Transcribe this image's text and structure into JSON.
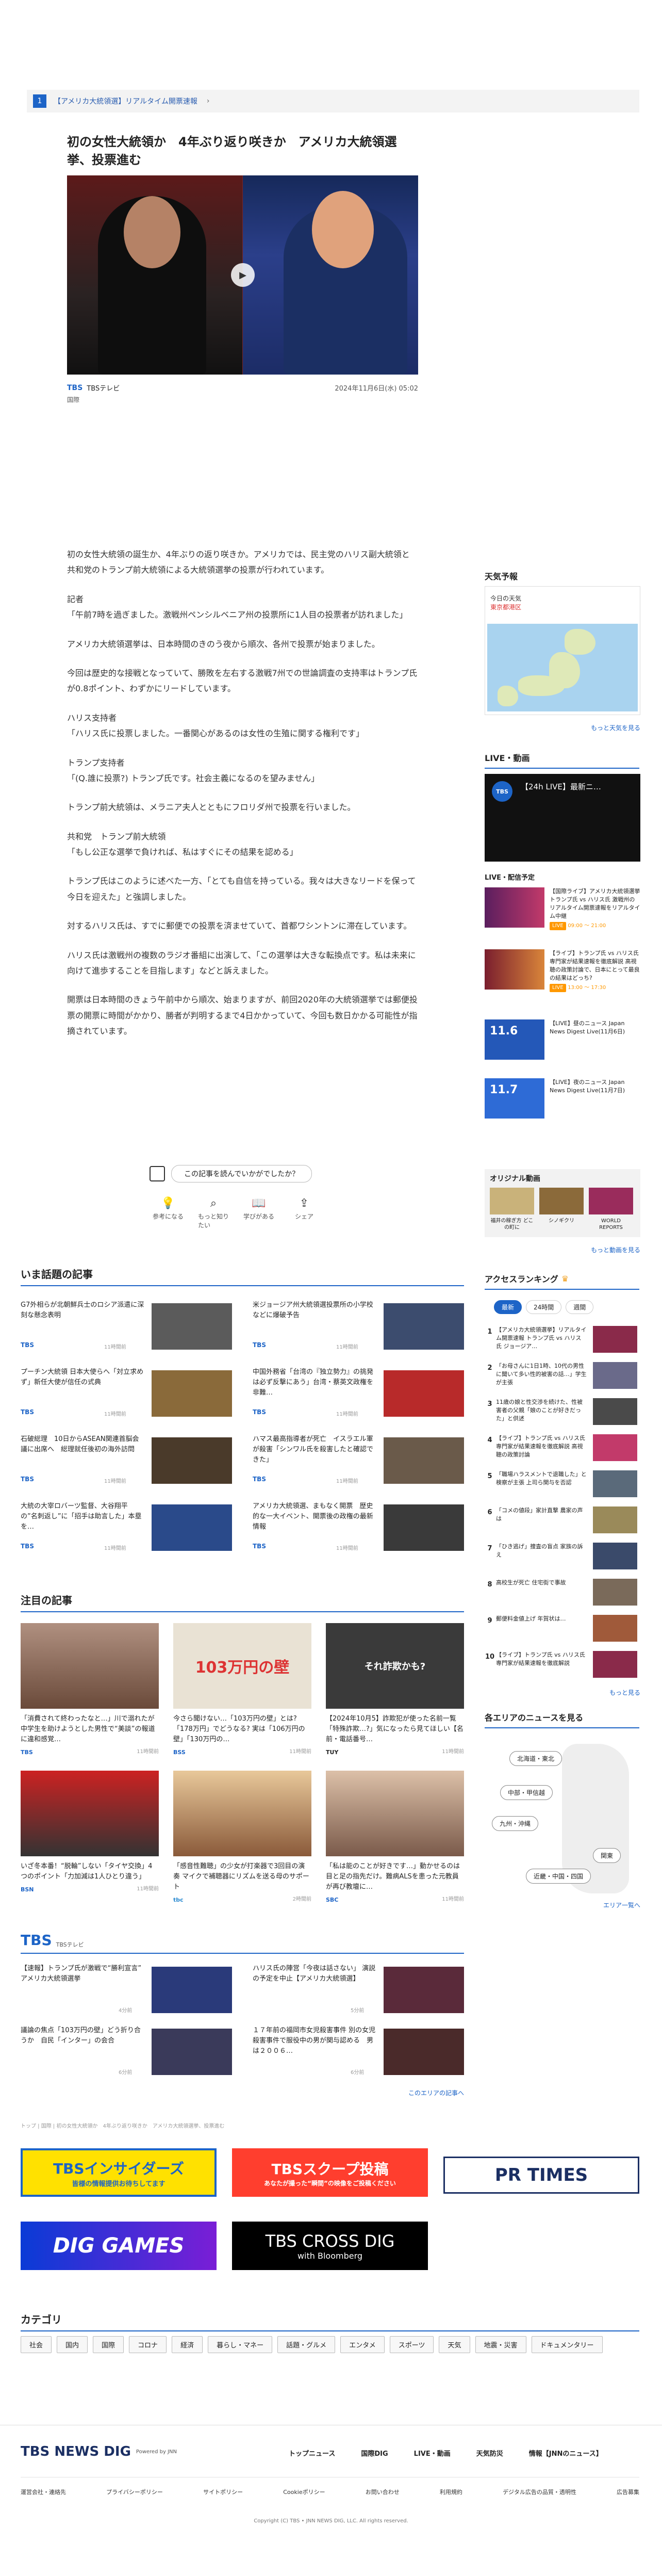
{
  "pager": {
    "num": "1",
    "label": "【アメリカ大統領選】リアルタイム開票速報"
  },
  "article": {
    "title": "初の女性大統領か　4年ぶり返り咲きか　アメリカ大統領選挙、投票進む",
    "media": "TBS",
    "media_sub": "TBSテレビ",
    "date": "2024年11月6日(水) 05:02",
    "category": "国際",
    "paragraphs": [
      "初の女性大統領の誕生か、4年ぶりの返り咲きか。アメリカでは、民主党のハリス副大統領と共和党のトランプ前大統領による大統領選挙の投票が行われています。",
      "記者\n「午前7時を過ぎました。激戦州ペンシルベニア州の投票所に1人目の投票者が訪れました」",
      "アメリカ大統領選挙は、日本時間のきのう夜から順次、各州で投票が始まりました。",
      "今回は歴史的な接戦となっていて、勝敗を左右する激戦7州での世論調査の支持率はトランプ氏が0.8ポイント、わずかにリードしています。",
      "ハリス支持者\n「ハリス氏に投票しました。一番関心があるのは女性の生殖に関する権利です」",
      "トランプ支持者\n「(Q.誰に投票?) トランプ氏です。社会主義になるのを望みません」",
      "トランプ前大統領は、メラニア夫人とともにフロリダ州で投票を行いました。",
      "共和党　トランプ前大統領\n「もし公正な選挙で負ければ、私はすぐにその結果を認める」",
      "トランプ氏はこのように述べた一方、「とても自信を持っている。我々は大きなリードを保って今日を迎えた」と強調しました。",
      "対するハリス氏は、すでに郵便での投票を済ませていて、首都ワシントンに滞在しています。",
      "ハリス氏は激戦州の複数のラジオ番組に出演して、「この選挙は大きな転換点です。私は未来に向けて進歩することを目指します」などと訴えました。",
      "開票は日本時間のきょう午前中から順次、始まりますが、前回2020年の大統領選挙では郵便投票の開票に時間がかかり、勝者が判明するまで4日かかっていて、今回も数日かかる可能性が指摘されています。"
    ],
    "feedback_label": "この記事を読んでいかがでしたか？",
    "reactions": [
      "参考になる",
      "もっと知りたい",
      "学びがある",
      "シェア"
    ]
  },
  "sidebar": {
    "weather_title": "天気予報",
    "weather_loc_prefix": "今日の天気",
    "weather_loc": "東京都港区",
    "weather_more": "もっと天気を見る",
    "live_title": "LIVE・動画",
    "live_video": "【24h LIVE】最新ニ…",
    "schedule_title": "LIVE・配信予定",
    "schedule": [
      {
        "text": "【国際ライブ】アメリカ大統領選挙 トランプ氏 vs ハリス氏 激戦州のリアルタイム開票速報をリアルタイム中継",
        "badge": "LIVE",
        "time": "09:00 〜 21:00"
      },
      {
        "text": "【ライブ】トランプ氏 vs ハリス氏 専門家が結果速報を徹底解説 高視聴の政策討論で、日本にとって最良の結果はどっち?",
        "badge": "LIVE",
        "time": "13:00 〜 17:30"
      },
      {
        "text": "【LIVE】昼のニュース Japan News Digest Live(11月6日)",
        "badge": "11.6",
        "time": ""
      },
      {
        "text": "【LIVE】夜のニュース Japan News Digest Live(11月7日)",
        "badge": "11.7",
        "time": ""
      }
    ],
    "original_title": "オリジナル動画",
    "original_items": [
      "福井の稼ぎ方 どこの町に",
      "シノギクリ",
      "WORLD REPORTS"
    ],
    "original_more": "もっと動画を見る",
    "ranking_title": "アクセスランキング",
    "ranking_tabs": [
      "最新",
      "24時間",
      "週間"
    ],
    "ranking": [
      "【アメリカ大統領選挙】リアルタイム開票速報 トランプ氏 vs ハリス氏 ジョージア…",
      "「お母さんに1日1時、10代の男性に聞いて多い性的被害の話…」学生が主張",
      "11歳の娘と性交渉を続けた、性被害者の父親「娘のことが好きだった」と供述",
      "【ライブ】トランプ氏 vs ハリス氏 専門家が結果速報を徹底解説 高視聴の政策討論",
      "「職場ハラスメントで退職した」と検察が主張 上司ら関与を否認",
      "「コメの値段」家計直撃 農家の声は",
      "「ひき逃げ」捜査の盲点 家族の訴え",
      "高校生が死亡 住宅街で事故",
      "郵便料金値上げ 年賀状は…",
      "【ライブ】トランプ氏 vs ハリス氏 専門家が結果速報を徹底解説"
    ],
    "ranking_more": "もっと見る",
    "area_title": "各エリアのニュースを見る",
    "areas": [
      "北海道・東北",
      "中部・甲信越",
      "九州・沖縄",
      "関東",
      "近畿・中国・四国"
    ],
    "area_more": "エリア一覧へ"
  },
  "topics": {
    "title": "いま話題の記事",
    "items": [
      {
        "t": "G7外相らが北朝鮮兵士のロシア派遣に深刻な懸念表明",
        "m": "TBS",
        "d": "11時間前"
      },
      {
        "t": "米ジョージア州大統領選投票所の小学校などに爆破予告",
        "m": "TBS",
        "d": "11時間前"
      },
      {
        "t": "プーチン大統領 日本大使らへ「対立求めず」新任大使が信任の式典",
        "m": "TBS",
        "d": "11時間前"
      },
      {
        "t": "中国外務省「台湾の『独立勢力』の挑発は必ず反撃にあう」台湾・蔡英文政権を非難…",
        "m": "TBS",
        "d": "11時間前"
      },
      {
        "t": "石破総理　10日からASEAN関連首脳会議に出席へ　総理就任後初の海外訪問",
        "m": "TBS",
        "d": "11時間前"
      },
      {
        "t": "ハマス最高指導者が死亡　イスラエル軍が殺害「シンワル氏を殺害したと確認できた」",
        "m": "TBS",
        "d": "11時間前"
      },
      {
        "t": "大統の大宰ロバーツ監督、大谷翔平の”名刺返し”に「招手は助言した」本塁を…",
        "m": "TBS",
        "d": "11時間前"
      },
      {
        "t": "アメリカ大統領選、まもなく開票　歴史的な一大イベント、開票後の政権の最新情報",
        "m": "TBS",
        "d": "11時間前"
      }
    ]
  },
  "featured": {
    "title": "注目の記事",
    "cards": [
      {
        "t": "「消費されて終わったなと…」川で溺れたが中学生を助けようとした男性で“美談”の報道に違和感覚…",
        "m": "TBS",
        "d": "11時間前",
        "img_text": ""
      },
      {
        "t": "今さら聞けない…「103万円の壁」とは? 「178万円」でどうなる? 実は「106万円の壁」「130万円の…",
        "m": "BSS",
        "d": "11時間前",
        "img_text": "103万円の壁"
      },
      {
        "t": "【2024年10月5】詐欺犯が使った名前一覧「特殊詐欺…?」気になったら見てほしい【名前・電話番号…",
        "m": "TUY",
        "d": "11時間前",
        "img_text": "それ詐欺かも?"
      },
      {
        "t": "いざ冬本番！“脱輪”しない「タイヤ交換」4つのポイント「力加減は1人ひとり違う」",
        "m": "BSN",
        "d": "11時間前",
        "img_text": ""
      },
      {
        "t": "「感音性難聴」の少女が打楽器で3回目の演奏 マイクで補聴器にリズムを送る母のサポート",
        "m": "tbc",
        "d": "2時間前",
        "img_text": ""
      },
      {
        "t": "「私は能のことが好きです…」動かせるのは目と足の指先だけ。難病ALSを患った元教員が再び教壇に…",
        "m": "SBC",
        "d": "11時間前",
        "img_text": ""
      }
    ]
  },
  "tbs_section": {
    "logo": "TBS",
    "sub": "TBSテレビ",
    "items": [
      {
        "t": "【速報】トランプ氏が激戦で“勝利宣言” アメリカ大統領選挙",
        "d": "4分前"
      },
      {
        "t": "ハリス氏の陣営「今夜は話さない」 演説の予定を中止【アメリカ大統領選】",
        "d": "5分前"
      },
      {
        "t": "議論の焦点「103万円の壁」どう折り合うか　自民「インター」の会合",
        "d": "6分前"
      },
      {
        "t": "１７年前の福岡市女児殺害事件 別の女児殺害事件で服役中の男が関与認める　男は２００６…",
        "d": "6分前"
      }
    ],
    "more": "このエリアの記事へ",
    "breadcrumb": "トップ | 国際 | 初の女性大統領か　4年ぶり返り咲きか　アメリカ大統領選挙、投票進む"
  },
  "banners": [
    {
      "title": "TBSインサイダーズ",
      "sub": "皆様の情報提供お待ちしてます"
    },
    {
      "title": "TBSスクープ投稿",
      "sub": "あなたが撮った“瞬間”の映像をご投稿ください"
    },
    {
      "title": "PR TIMES",
      "sub": ""
    },
    {
      "title": "DIG GAMES",
      "sub": ""
    },
    {
      "title": "TBS CROSS DIG",
      "sub": "with Bloomberg"
    }
  ],
  "categories": {
    "title": "カテゴリ",
    "items": [
      "社会",
      "国内",
      "国際",
      "コロナ",
      "経済",
      "暮らし・マネー",
      "話題・グルメ",
      "エンタメ",
      "スポーツ",
      "天気",
      "地震・災害",
      "ドキュメンタリー"
    ]
  },
  "footer": {
    "logo": "TBS NEWS DIG",
    "logo_sub": "Powered by JNN",
    "nav": [
      "トップニュース",
      "国際DIG",
      "LIVE・動画",
      "天気防災",
      "情報【JNNのニュース】"
    ],
    "links": [
      "運営会社・連絡先",
      "プライバシーポリシー",
      "サイトポリシー",
      "Cookieポリシー",
      "お問い合わせ",
      "利用規約",
      "デジタル広告の品質・透明性",
      "広告募集"
    ],
    "copyright": "Copyright (C) TBS • JNN NEWS DIG, LLC. All rights reserved."
  }
}
